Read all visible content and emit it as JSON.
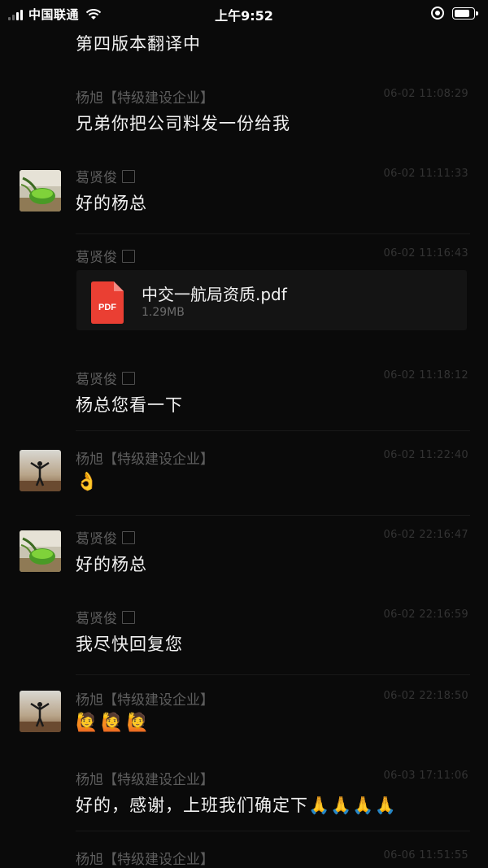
{
  "status_bar": {
    "carrier": "中国联通",
    "time": "上午9:52"
  },
  "messages": [
    {
      "text": "第四版本翻译中"
    },
    {
      "sender": "杨旭【特级建设企业】",
      "time": "06-02 11:08:29",
      "text": "兄弟你把公司料发一份给我"
    },
    {
      "sender": "葛贤俊",
      "time": "06-02 11:11:33",
      "text": "好的杨总"
    },
    {
      "sender": "葛贤俊",
      "time": "06-02 11:16:43",
      "file": {
        "name": "中交一航局资质.pdf",
        "size": "1.29MB",
        "icon_label": "PDF"
      }
    },
    {
      "sender": "葛贤俊",
      "time": "06-02 11:18:12",
      "text": "杨总您看一下"
    },
    {
      "sender": "杨旭【特级建设企业】",
      "time": "06-02 11:22:40",
      "text": "👌"
    },
    {
      "sender": "葛贤俊",
      "time": "06-02 22:16:47",
      "text": "好的杨总"
    },
    {
      "sender": "葛贤俊",
      "time": "06-02 22:16:59",
      "text": "我尽快回复您"
    },
    {
      "sender": "杨旭【特级建设企业】",
      "time": "06-02 22:18:50",
      "text": "🙋🙋🙋"
    },
    {
      "sender": "杨旭【特级建设企业】",
      "time": "06-03 17:11:06",
      "text": "好的，感谢，上班我们确定下🙏🙏🙏🙏"
    },
    {
      "sender": "杨旭【特级建设企业】",
      "time": "06-06 11:51:55"
    }
  ],
  "colors": {
    "background": "#0a0a0a",
    "pdf_red": "#ea3f33",
    "name_gray": "#5e5e5e"
  }
}
